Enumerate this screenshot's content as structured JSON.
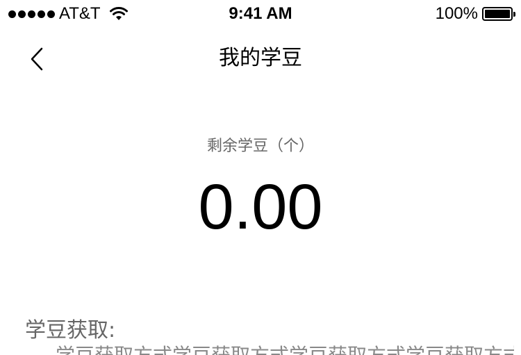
{
  "status_bar": {
    "carrier": "AT&T",
    "time": "9:41 AM",
    "battery_percent": "100%"
  },
  "nav": {
    "title": "我的学豆",
    "back_icon": "chevron-left-icon"
  },
  "balance": {
    "label": "剩余学豆（个）",
    "value": "0.00"
  },
  "section": {
    "title": "学豆获取:",
    "body": "学豆获取方式学豆获取方式学豆获取方式学豆获取方式学豆"
  }
}
